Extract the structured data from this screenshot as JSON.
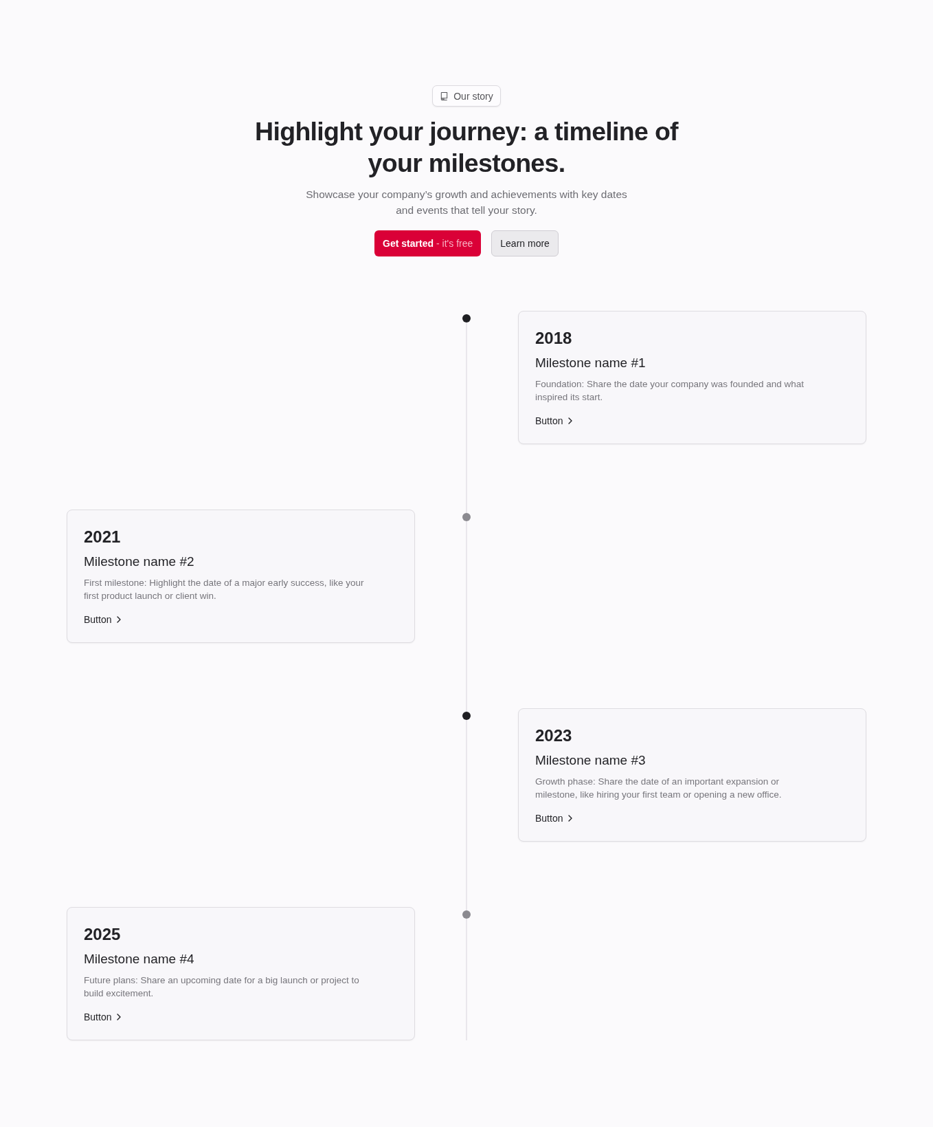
{
  "tag": {
    "label": "Our story"
  },
  "hero": {
    "title": "Highlight your journey: a timeline of your milestones.",
    "subtitle": "Showcase your company’s growth and achievements with key dates and events that tell your story."
  },
  "actions": [
    {
      "kind": "primary",
      "label": "Get started",
      "note": "- it's free"
    },
    {
      "kind": "secondary",
      "label": "Learn more"
    }
  ],
  "milestones": [
    {
      "year": "2018",
      "name": "Milestone name #1",
      "description": "Foundation: Share the date your company was founded and what inspired its start.",
      "link": "Button",
      "active": true
    },
    {
      "year": "2021",
      "name": "Milestone name #2",
      "description": "First milestone: Highlight the date of a major early success, like your first product launch or client win.",
      "link": "Button",
      "active": false
    },
    {
      "year": "2023",
      "name": "Milestone name #3",
      "description": "Growth phase: Share the date of an important expansion or milestone, like hiring your first team or opening a new office.",
      "link": "Button",
      "active": true
    },
    {
      "year": "2025",
      "name": "Milestone name #4",
      "description": "Future plans: Share an upcoming date for a big launch or project to build excitement.",
      "link": "Button",
      "active": false
    }
  ]
}
